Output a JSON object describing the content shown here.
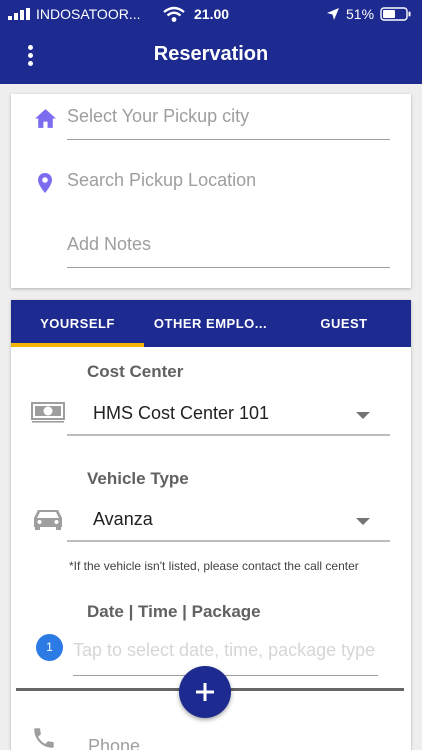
{
  "status_bar": {
    "carrier": "INDOSATOOR...",
    "time": "21.00",
    "battery": "51%"
  },
  "app_bar": {
    "title": "Reservation"
  },
  "pickup_card": {
    "city_placeholder": "Select Your Pickup city",
    "location_placeholder": "Search Pickup Location",
    "notes_placeholder": "Add Notes"
  },
  "tabs": {
    "items": [
      "YOURSELF",
      "OTHER EMPLO...",
      "GUEST"
    ],
    "active": "YOURSELF",
    "indicator_color": "#f5b400"
  },
  "form": {
    "cost_center": {
      "label": "Cost Center",
      "value": "HMS Cost Center 101"
    },
    "vehicle_type": {
      "label": "Vehicle Type",
      "value": "Avanza",
      "note": "*If the vehicle isn't listed, please contact the call center"
    },
    "date_time": {
      "step": "1",
      "label": "Date | Time | Package",
      "placeholder": "Tap to select date, time, package type"
    },
    "phone": {
      "placeholder": "Phone"
    }
  },
  "colors": {
    "primary": "#1d2a8f",
    "icon_purple": "#7b6cf0",
    "badge_blue": "#2c7be5"
  }
}
